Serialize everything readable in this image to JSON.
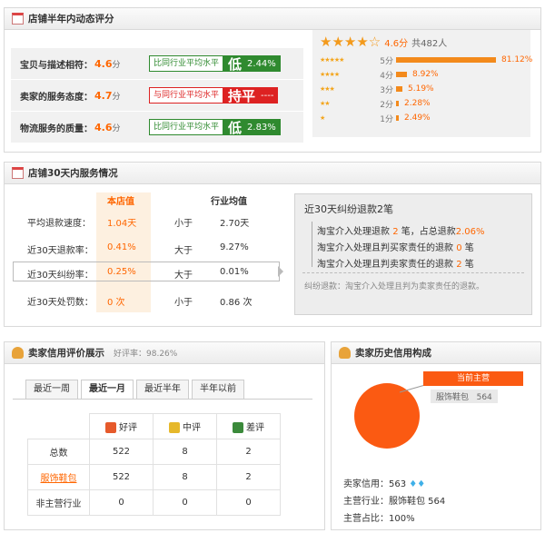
{
  "dsr": {
    "title": "店铺半年内动态评分",
    "rows": [
      {
        "label": "宝贝与描述相符：",
        "score": "4.6",
        "unit": "分",
        "cmp_text": "比同行业平均水平",
        "cmp_word": "低",
        "cmp_pct": "2.44%",
        "color": "#2f8a2f"
      },
      {
        "label": "卖家的服务态度：",
        "score": "4.7",
        "unit": "分",
        "cmp_text": "与同行业平均水平",
        "cmp_word": "持平",
        "cmp_pct": "----",
        "color": "#d22222"
      },
      {
        "label": "物流服务的质量：",
        "score": "4.6",
        "unit": "分",
        "cmp_text": "比同行业平均水平",
        "cmp_word": "低",
        "cmp_pct": "2.83%",
        "color": "#2f8a2f"
      }
    ],
    "rating": {
      "avg": "4.6",
      "unit": "分",
      "total": "共482人"
    },
    "dist": [
      {
        "level": "5分",
        "pct": "81.12%",
        "value": 81.12
      },
      {
        "level": "4分",
        "pct": "8.92%",
        "value": 8.92
      },
      {
        "level": "3分",
        "pct": "5.19%",
        "value": 5.19
      },
      {
        "level": "2分",
        "pct": "2.28%",
        "value": 2.28
      },
      {
        "level": "1分",
        "pct": "2.49%",
        "value": 2.49
      }
    ]
  },
  "service": {
    "title": "店铺30天内服务情况",
    "col_store": "本店值",
    "col_avg": "行业均值",
    "rows": [
      {
        "label": "平均退款速度：",
        "store": "1.04天",
        "rel": "小于",
        "avg": "2.70天"
      },
      {
        "label": "近30天退款率：",
        "store": "0.41%",
        "rel": "大于",
        "avg": "9.27%"
      },
      {
        "label": "近30天纠纷率：",
        "store": "0.25%",
        "rel": "大于",
        "avg": "0.01%"
      },
      {
        "label": "近30天处罚数：",
        "store": "0 次",
        "rel": "小于",
        "avg": "0.86 次"
      }
    ],
    "dispute": {
      "title": "近30天纠纷退款2笔",
      "lines": [
        {
          "a": "淘宝介入处理退款",
          "b": "2",
          "c": "笔，占总退款",
          "d": "2.06%"
        },
        {
          "a": "淘宝介入处理且判买家责任的退款",
          "b": "0",
          "c": "笔",
          "d": ""
        },
        {
          "a": "淘宝介入处理且判卖家责任的退款",
          "b": "2",
          "c": "笔",
          "d": ""
        }
      ],
      "note": "纠纷退款：淘宝介入处理且判为卖家责任的退款。"
    }
  },
  "credit": {
    "title": "卖家信用评价展示",
    "good_rate": "好评率：98.26%",
    "tabs": [
      "最近一周",
      "最近一月",
      "最近半年",
      "半年以前"
    ],
    "active_tab": 1,
    "cols": [
      "好评",
      "中评",
      "差评"
    ],
    "rows": [
      {
        "label": "总数",
        "values": [
          "522",
          "8",
          "2"
        ]
      },
      {
        "label": "服饰鞋包",
        "values": [
          "522",
          "8",
          "2"
        ]
      },
      {
        "label": "非主营行业",
        "values": [
          "0",
          "0",
          "0"
        ]
      }
    ]
  },
  "history": {
    "title": "卖家历史信用构成",
    "main_label": "当前主营",
    "legend_item": "服饰鞋包",
    "legend_val": "564",
    "seller_credit_label": "卖家信用：",
    "seller_credit_val": "563",
    "main_industry_label": "主营行业：",
    "main_industry_val": "服饰鞋包  564",
    "main_ratio_label": "主营占比：",
    "main_ratio_val": "100%",
    "chart_color": "#fb5a12"
  }
}
